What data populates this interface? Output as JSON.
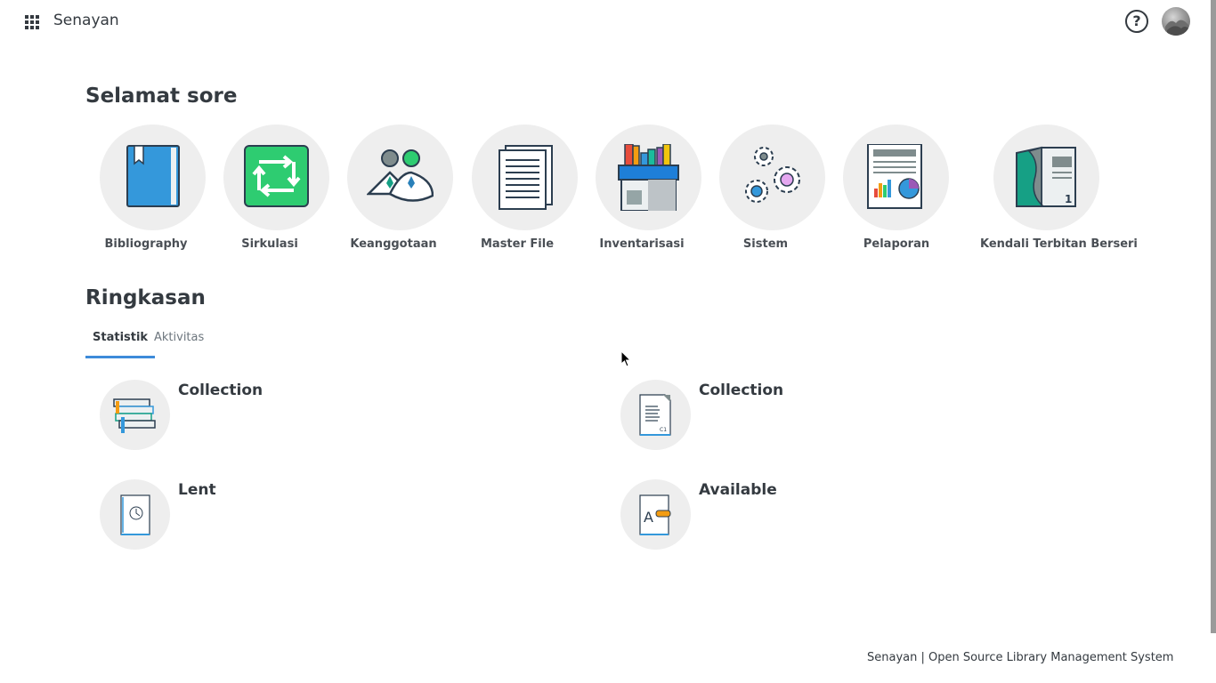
{
  "header": {
    "apps_icon": "apps-grid-icon",
    "brand": "Senayan",
    "help_icon": "help-circle-icon",
    "help_glyph": "?",
    "avatar_icon": "user-avatar"
  },
  "greeting": "Selamat sore",
  "modules": [
    {
      "label": "Bibliography",
      "icon": "book-icon"
    },
    {
      "label": "Sirkulasi",
      "icon": "circulation-icon"
    },
    {
      "label": "Keanggotaan",
      "icon": "members-icon"
    },
    {
      "label": "Master File",
      "icon": "documents-icon"
    },
    {
      "label": "Inventarisasi",
      "icon": "inventory-icon"
    },
    {
      "label": "Sistem",
      "icon": "gears-icon"
    },
    {
      "label": "Pelaporan",
      "icon": "report-icon"
    },
    {
      "label": "Kendali Terbitan Berseri",
      "icon": "serial-icon"
    }
  ],
  "summary": {
    "title": "Ringkasan",
    "tabs": [
      {
        "label": "Statistik",
        "active": true
      },
      {
        "label": "Aktivitas",
        "active": false
      }
    ],
    "stats": [
      {
        "title": "Collection",
        "icon": "books-stack-icon"
      },
      {
        "title": "Collection",
        "icon": "catalog-card-icon"
      },
      {
        "title": "Lent",
        "icon": "lent-book-icon"
      },
      {
        "title": "Available",
        "icon": "available-book-icon"
      }
    ]
  },
  "footer": "Senayan | Open Source Library Management System",
  "colors": {
    "accent": "#3d8bd9",
    "text": "#343a40",
    "circle_bg": "#eeeeee",
    "green": "#2ecc71",
    "blue": "#3498db"
  }
}
